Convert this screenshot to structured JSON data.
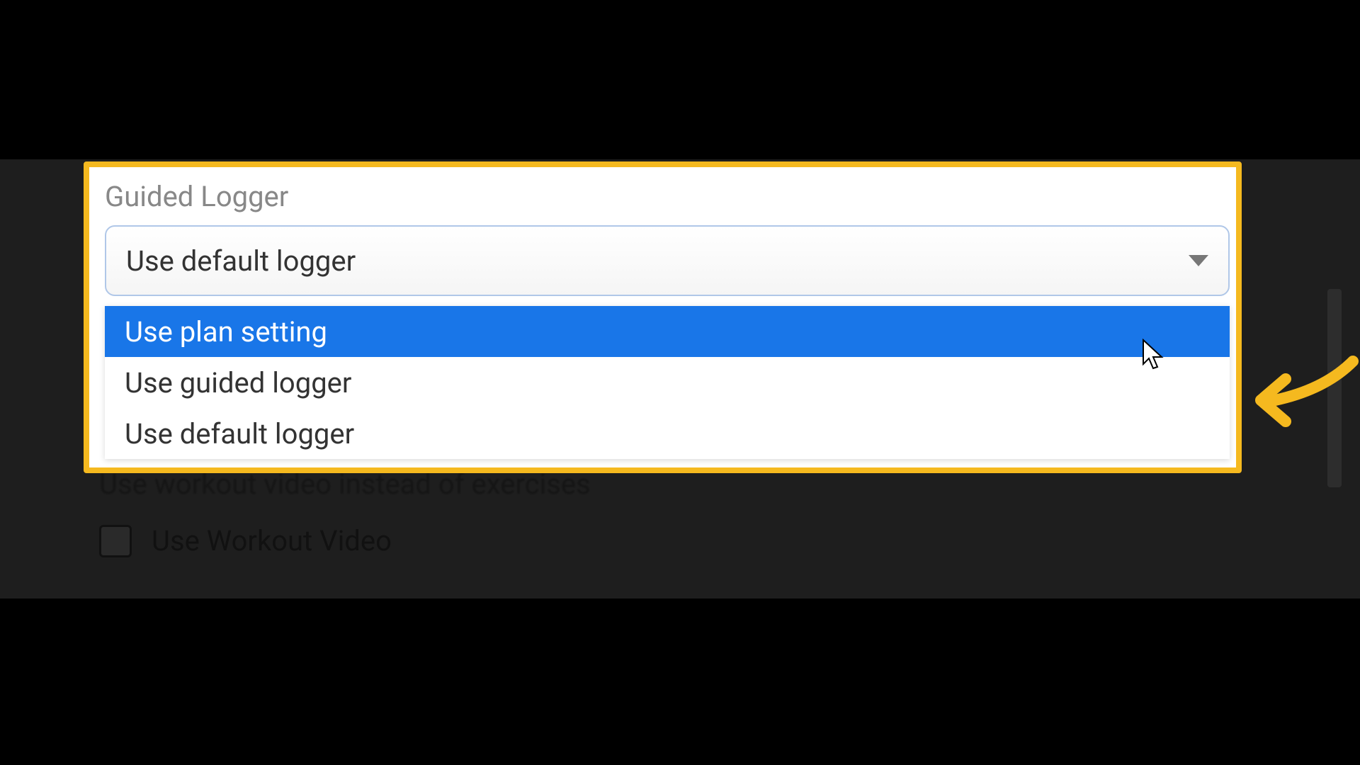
{
  "section": {
    "label": "Guided Logger"
  },
  "dropdown": {
    "selected": "Use default logger",
    "options": [
      {
        "label": "Use plan setting",
        "highlighted": true
      },
      {
        "label": "Use guided logger",
        "highlighted": false
      },
      {
        "label": "Use default logger",
        "highlighted": false
      }
    ]
  },
  "below": {
    "heading": "Use workout video instead of exercises",
    "checkbox_label": "Use Workout Video"
  }
}
